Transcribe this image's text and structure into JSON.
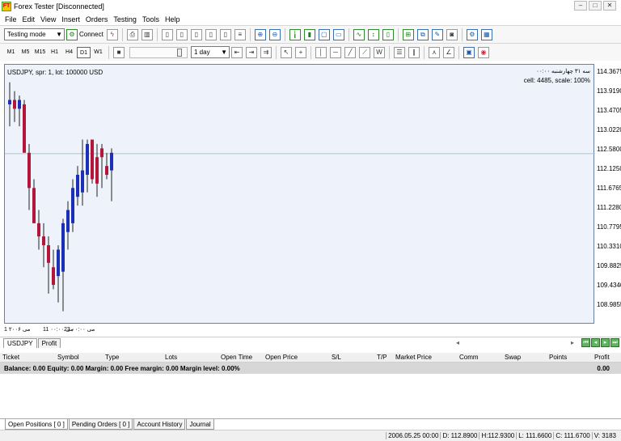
{
  "window": {
    "title": "Forex Tester [Disconnected]"
  },
  "menu": [
    "File",
    "Edit",
    "View",
    "Insert",
    "Orders",
    "Testing",
    "Tools",
    "Help"
  ],
  "toolbar": {
    "mode": "Testing mode",
    "connect": "Connect"
  },
  "timeframes": [
    "M1",
    "M5",
    "M15",
    "H1",
    "H4",
    "D1",
    "W1"
  ],
  "active_timeframe": "D1",
  "period_select": "1 day",
  "chart": {
    "info": "USDJPY, spr: 1, lot: 100000 USD",
    "corner_date": "سه ۳۱ چهارشنبه ۰۰:۰۰",
    "corner_info": "cell: 4485, scale: 100%",
    "current_price": "112.580",
    "y_ticks": [
      "114.3675",
      "113.9190",
      "113.4705",
      "113.0220",
      "112.5800",
      "112.1250",
      "111.6765",
      "111.2280",
      "110.7795",
      "110.3310",
      "109.8825",
      "109.4340",
      "108.9855"
    ],
    "x_ticks": [
      "1 ۲۰۰۶ می",
      "11 ۰۰:۰۰ می",
      "23 ۰۰:۰۰ می"
    ]
  },
  "chart_data": {
    "type": "candlestick",
    "ylim": [
      108.7,
      114.6
    ],
    "candles": [
      {
        "o": 113.7,
        "h": 114.2,
        "l": 113.2,
        "c": 113.8
      },
      {
        "o": 113.8,
        "h": 114.0,
        "l": 113.3,
        "c": 113.6
      },
      {
        "o": 113.6,
        "h": 113.9,
        "l": 113.2,
        "c": 113.8
      },
      {
        "o": 113.7,
        "h": 113.8,
        "l": 112.7,
        "c": 112.6
      },
      {
        "o": 112.6,
        "h": 112.8,
        "l": 111.3,
        "c": 111.8
      },
      {
        "o": 111.8,
        "h": 112.0,
        "l": 111.0,
        "c": 111.0
      },
      {
        "o": 111.0,
        "h": 111.3,
        "l": 110.4,
        "c": 110.7
      },
      {
        "o": 110.7,
        "h": 111.0,
        "l": 110.0,
        "c": 110.5
      },
      {
        "o": 110.5,
        "h": 110.7,
        "l": 109.4,
        "c": 110.1
      },
      {
        "o": 110.0,
        "h": 110.4,
        "l": 109.5,
        "c": 109.6
      },
      {
        "o": 109.8,
        "h": 110.5,
        "l": 109.2,
        "c": 110.4
      },
      {
        "o": 109.9,
        "h": 111.1,
        "l": 109.0,
        "c": 111.0
      },
      {
        "o": 110.8,
        "h": 111.5,
        "l": 110.4,
        "c": 111.3
      },
      {
        "o": 111.0,
        "h": 112.0,
        "l": 110.8,
        "c": 111.8
      },
      {
        "o": 111.6,
        "h": 112.3,
        "l": 111.4,
        "c": 112.1
      },
      {
        "o": 111.7,
        "h": 112.9,
        "l": 111.4,
        "c": 112.2
      },
      {
        "o": 112.1,
        "h": 112.9,
        "l": 111.7,
        "c": 112.8
      },
      {
        "o": 112.9,
        "h": 112.9,
        "l": 111.9,
        "c": 112.0
      },
      {
        "o": 112.5,
        "h": 112.8,
        "l": 111.6,
        "c": 111.9
      },
      {
        "o": 112.7,
        "h": 112.8,
        "l": 111.8,
        "c": 112.5
      },
      {
        "o": 112.3,
        "h": 112.6,
        "l": 112.0,
        "c": 112.1
      },
      {
        "o": 112.2,
        "h": 112.7,
        "l": 111.5,
        "c": 112.6
      }
    ]
  },
  "chart_tabs": [
    "USDJPY",
    "Profit"
  ],
  "orders_table": {
    "columns": [
      "Ticket",
      "Symbol",
      "Type",
      "Lots",
      "Open Time",
      "Open Price",
      "S/L",
      "T/P",
      "Market Price",
      "Comm",
      "Swap",
      "Points",
      "Profit"
    ]
  },
  "summary": {
    "text": "Balance: 0.00 Equity: 0.00 Margin: 0.00 Free margin: 0.00 Margin level: 0.00%",
    "profit": "0.00"
  },
  "bottom_tabs": [
    "Open Positions [ 0 ]",
    "Pending Orders [ 0 ]",
    "Account History",
    "Journal"
  ],
  "status": {
    "date": "2006.05.25 00:00",
    "open": "D: 112.8900",
    "high": "H:112.9300",
    "low": "L: 111.6600",
    "close": "C: 111.6700",
    "volume": "V: 3183"
  }
}
